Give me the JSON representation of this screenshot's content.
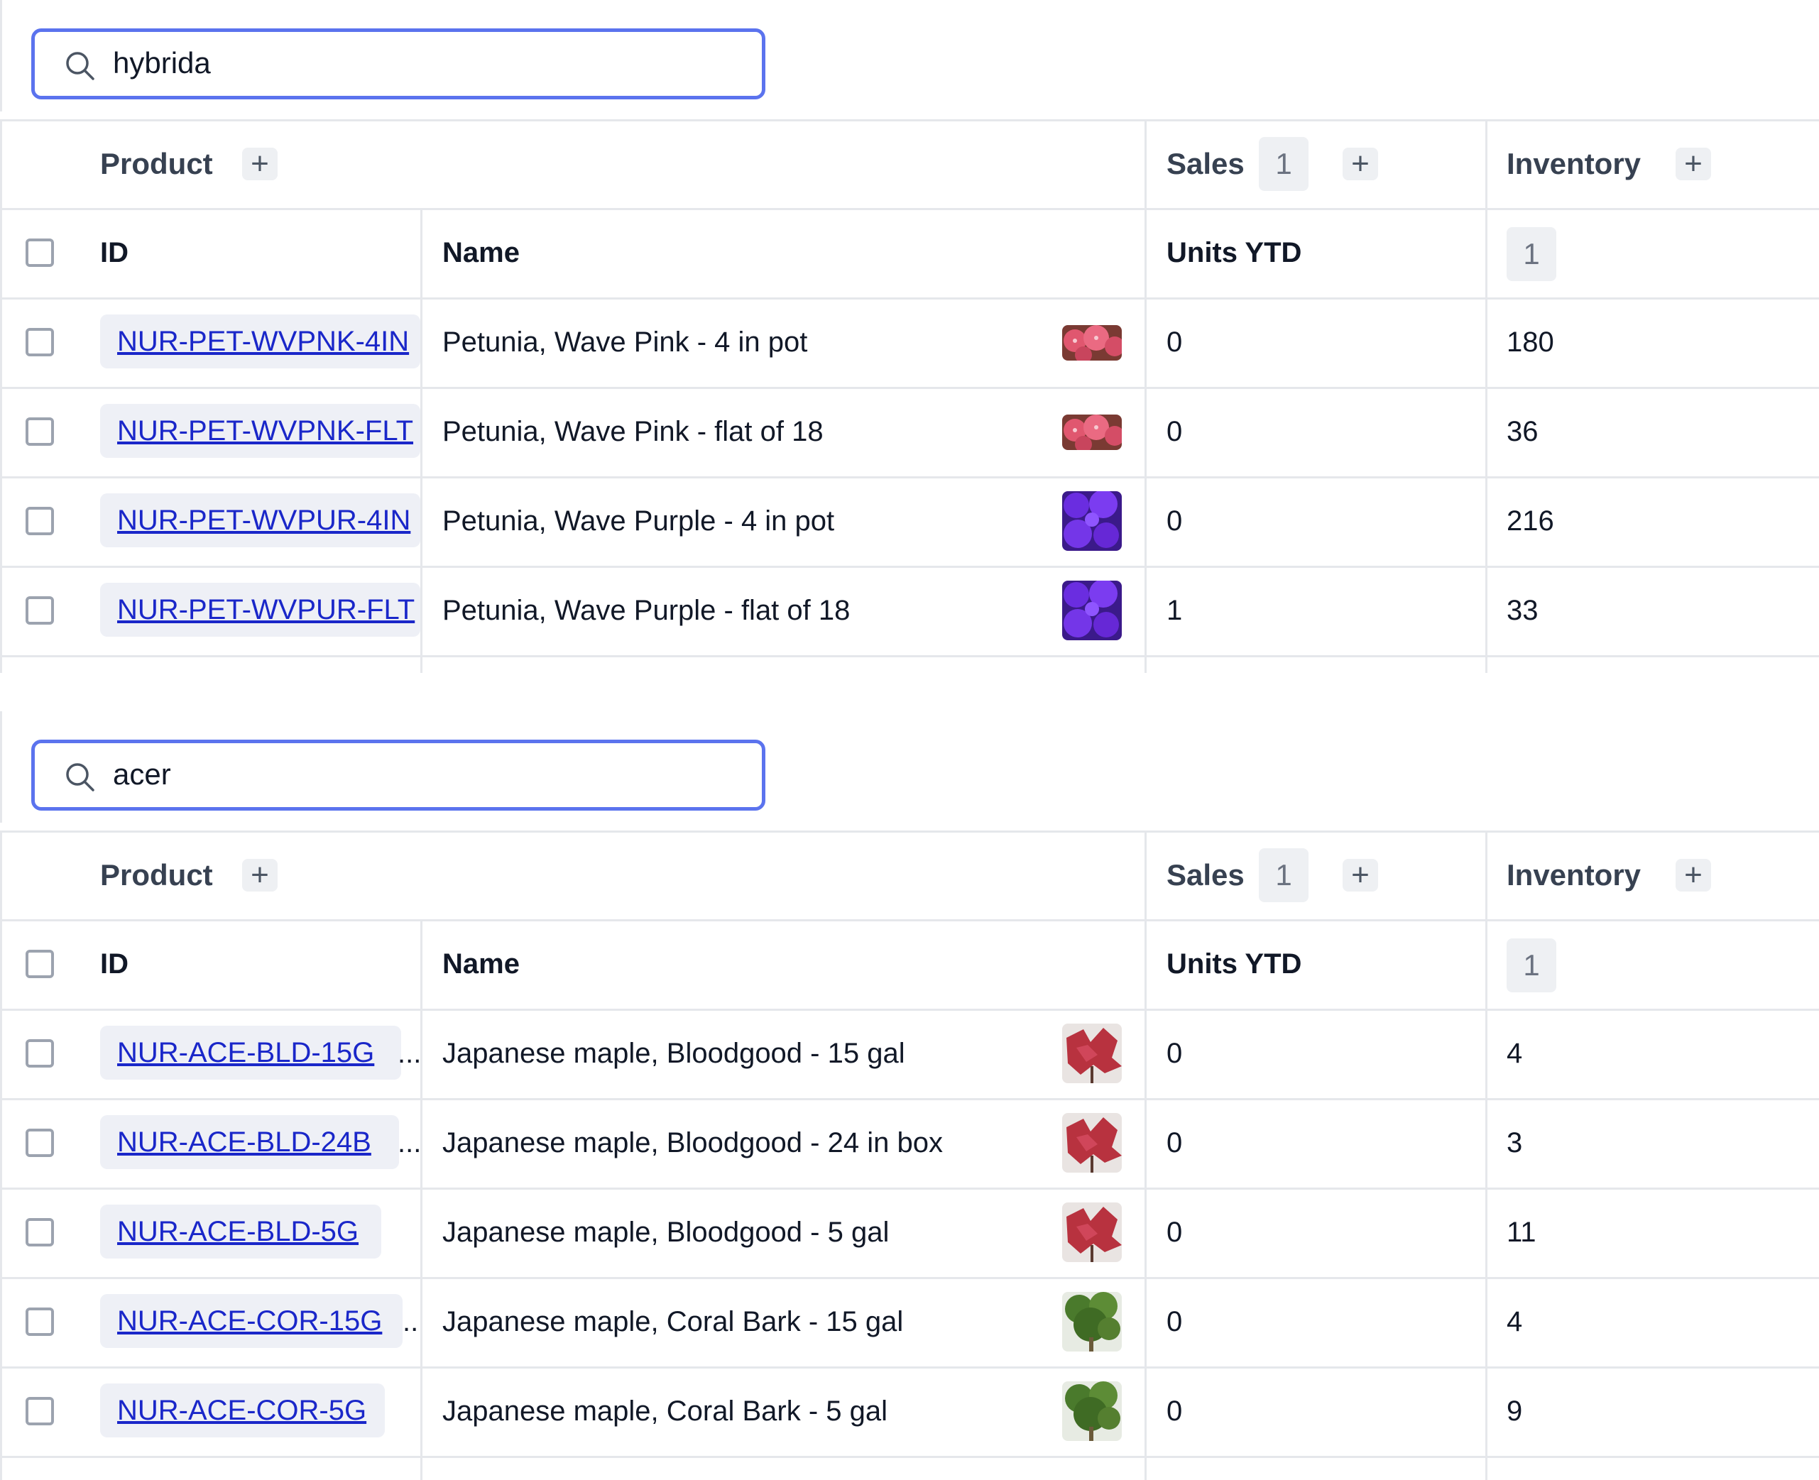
{
  "panels": [
    {
      "search": {
        "value": "hybrida"
      },
      "header": {
        "product_label": "Product",
        "sales_label": "Sales",
        "sales_count": "1",
        "inventory_label": "Inventory",
        "plus": "+",
        "col_id": "ID",
        "col_name": "Name",
        "col_units": "Units YTD",
        "inventory_count": "1"
      },
      "rows": [
        {
          "id": "NUR-PET-WVPNK-4IN",
          "name": "Petunia, Wave Pink - 4 in pot",
          "units": "0",
          "inventory": "180",
          "thumb": "pink-petunia"
        },
        {
          "id": "NUR-PET-WVPNK-FLT",
          "name": "Petunia, Wave Pink - flat of 18",
          "units": "0",
          "inventory": "36",
          "thumb": "pink-petunia"
        },
        {
          "id": "NUR-PET-WVPUR-4IN",
          "name": "Petunia, Wave Purple - 4 in pot",
          "units": "0",
          "inventory": "216",
          "thumb": "purple-petunia"
        },
        {
          "id": "NUR-PET-WVPUR-FLT",
          "name": "Petunia, Wave Purple - flat of 18",
          "units": "1",
          "inventory": "33",
          "thumb": "purple-petunia"
        }
      ]
    },
    {
      "search": {
        "value": "acer"
      },
      "header": {
        "product_label": "Product",
        "sales_label": "Sales",
        "sales_count": "1",
        "inventory_label": "Inventory",
        "plus": "+",
        "col_id": "ID",
        "col_name": "Name",
        "col_units": "Units YTD",
        "inventory_count": "1"
      },
      "rows": [
        {
          "id": "NUR-ACE-BLD-15G",
          "ellipsis": "...",
          "name": "Japanese maple, Bloodgood - 15 gal",
          "units": "0",
          "inventory": "4",
          "thumb": "red-maple"
        },
        {
          "id": "NUR-ACE-BLD-24B",
          "ellipsis": "...",
          "name": "Japanese maple, Bloodgood - 24 in box",
          "units": "0",
          "inventory": "3",
          "thumb": "red-maple"
        },
        {
          "id": "NUR-ACE-BLD-5G",
          "name": "Japanese maple, Bloodgood - 5 gal",
          "units": "0",
          "inventory": "11",
          "thumb": "red-maple"
        },
        {
          "id": "NUR-ACE-COR-15G",
          "ellipsis": "..",
          "name": "Japanese maple, Coral Bark - 15 gal",
          "units": "0",
          "inventory": "4",
          "thumb": "green-maple"
        },
        {
          "id": "NUR-ACE-COR-5G",
          "name": "Japanese maple, Coral Bark - 5 gal",
          "units": "0",
          "inventory": "9",
          "thumb": "green-maple"
        }
      ]
    }
  ],
  "colors": {
    "accent": "#5b73ee",
    "link": "#1a27c9",
    "chip": "#eef0f6",
    "border": "#e5e7eb"
  }
}
